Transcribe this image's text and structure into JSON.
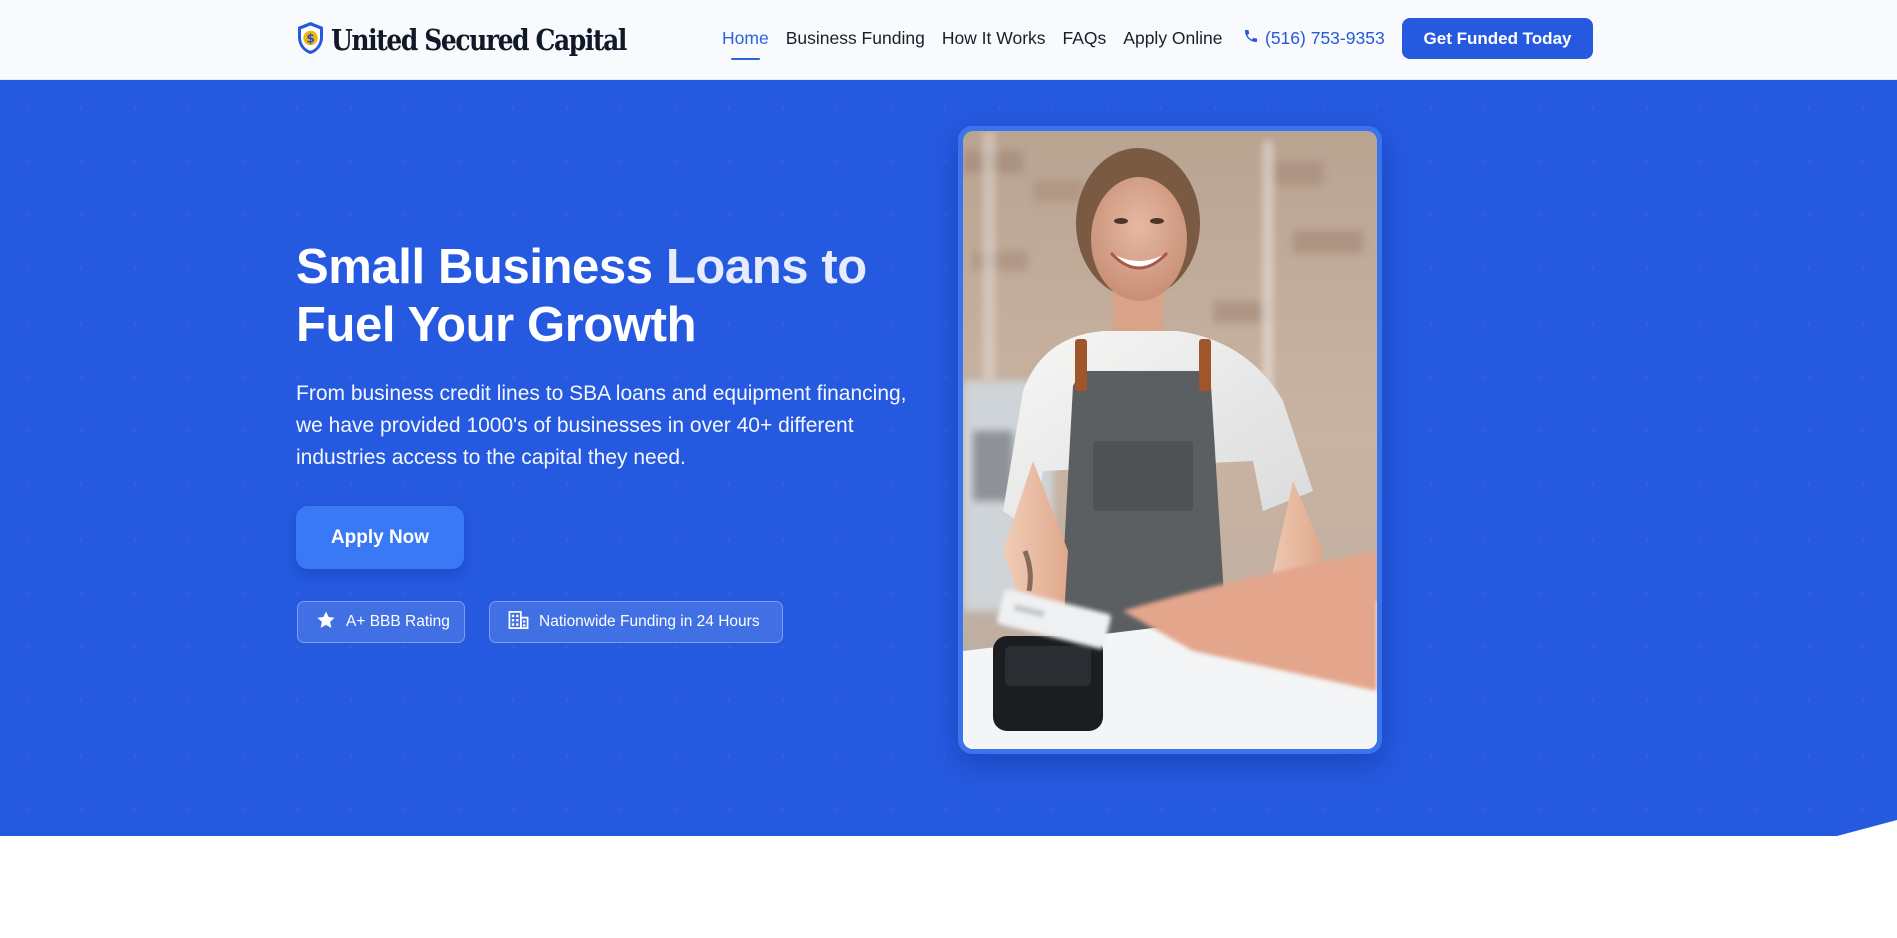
{
  "header": {
    "brand_name": "United Secured Capital",
    "nav": [
      {
        "label": "Home",
        "active": true
      },
      {
        "label": "Business Funding",
        "active": false
      },
      {
        "label": "How It Works",
        "active": false
      },
      {
        "label": "FAQs",
        "active": false
      },
      {
        "label": "Apply Online",
        "active": false
      }
    ],
    "phone": "(516) 753-9353",
    "cta": "Get Funded Today"
  },
  "hero": {
    "title_part1": "Small Business ",
    "title_part2": "Loans to",
    "title_part3": "Fuel Your Growth",
    "subtitle": "From business credit lines to SBA loans and equipment financing, we have provided 1000's of businesses in over 40+ different industries access to the capital they need.",
    "apply_button": "Apply Now",
    "badges": [
      {
        "icon": "star-icon",
        "label": "A+ BBB Rating"
      },
      {
        "icon": "building-icon",
        "label": "Nationwide Funding in 24 Hours"
      }
    ]
  },
  "colors": {
    "primary": "#2459e0",
    "hero_bg": "#255ae0",
    "nav_active": "#2d62dd",
    "text_dark": "#1b1f2a"
  }
}
